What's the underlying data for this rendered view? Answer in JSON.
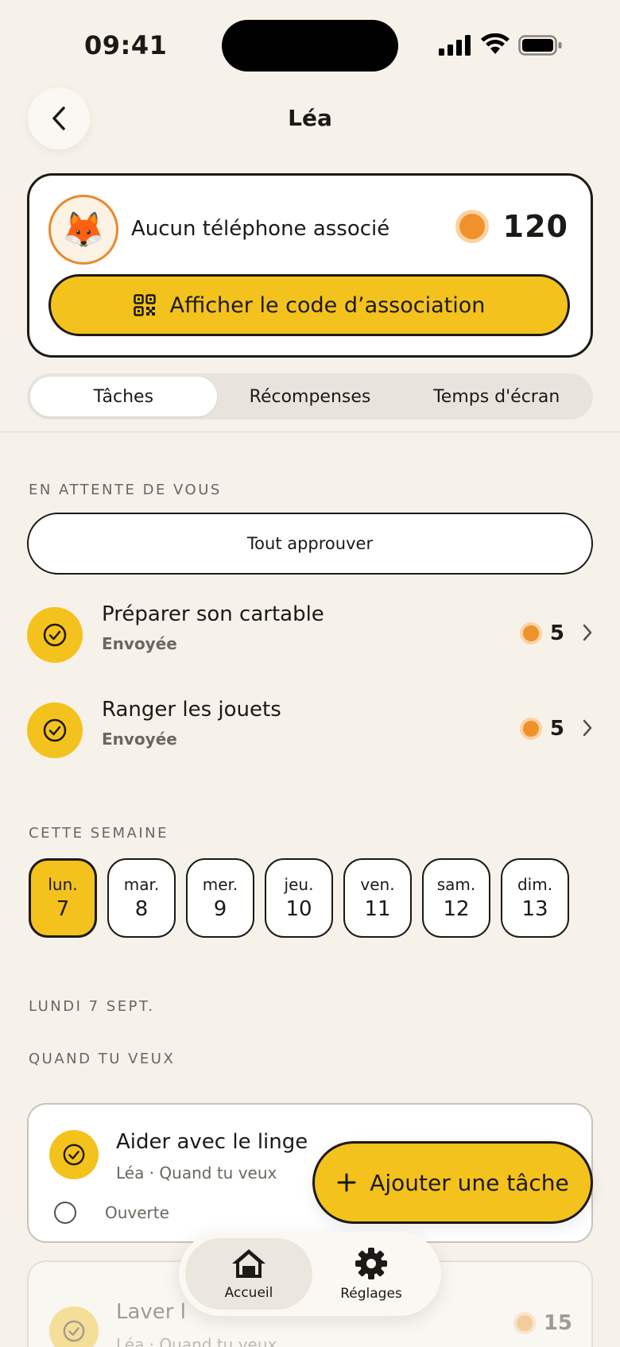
{
  "status_bar": {
    "time": "09:41"
  },
  "header": {
    "title": "Léa"
  },
  "profile": {
    "avatar_emoji": "🦊",
    "device_status": "Aucun téléphone associé",
    "coins": "120",
    "pair_button": "Afficher le code d’association"
  },
  "tabs": [
    {
      "label": "Tâches",
      "active": true
    },
    {
      "label": "Récompenses"
    },
    {
      "label": "Temps d'écran"
    }
  ],
  "pending": {
    "section_label": "EN ATTENTE DE VOUS",
    "approve_all": "Tout approuver",
    "tasks": [
      {
        "title": "Préparer son cartable",
        "status": "Envoyée",
        "reward": "5"
      },
      {
        "title": "Ranger les jouets",
        "status": "Envoyée",
        "reward": "5"
      }
    ]
  },
  "week": {
    "section_label": "CETTE SEMAINE",
    "days": [
      {
        "name": "lun.",
        "date": "7",
        "active": true
      },
      {
        "name": "mar.",
        "date": "8"
      },
      {
        "name": "mer.",
        "date": "9"
      },
      {
        "name": "jeu.",
        "date": "10"
      },
      {
        "name": "ven.",
        "date": "11"
      },
      {
        "name": "sam.",
        "date": "12"
      },
      {
        "name": "dim.",
        "date": "13"
      }
    ]
  },
  "day_section": {
    "date_label": "LUNDI 7 SEPT.",
    "group_label": "QUAND TU VEUX",
    "cards": [
      {
        "title": "Aider avec le linge",
        "meta": "Léa · Quand tu veux",
        "state": "Ouverte"
      },
      {
        "title": "Laver l",
        "meta": "Léa · Quand tu veux",
        "reward": "15"
      }
    ]
  },
  "fab": {
    "label": "Ajouter une tâche"
  },
  "tabbar": [
    {
      "label": "Accueil",
      "icon": "home-icon",
      "active": true
    },
    {
      "label": "Réglages",
      "icon": "gear-icon"
    }
  ],
  "colors": {
    "accent": "#f4c21c",
    "coin": "#f0922b",
    "background": "#f6f2ea"
  }
}
